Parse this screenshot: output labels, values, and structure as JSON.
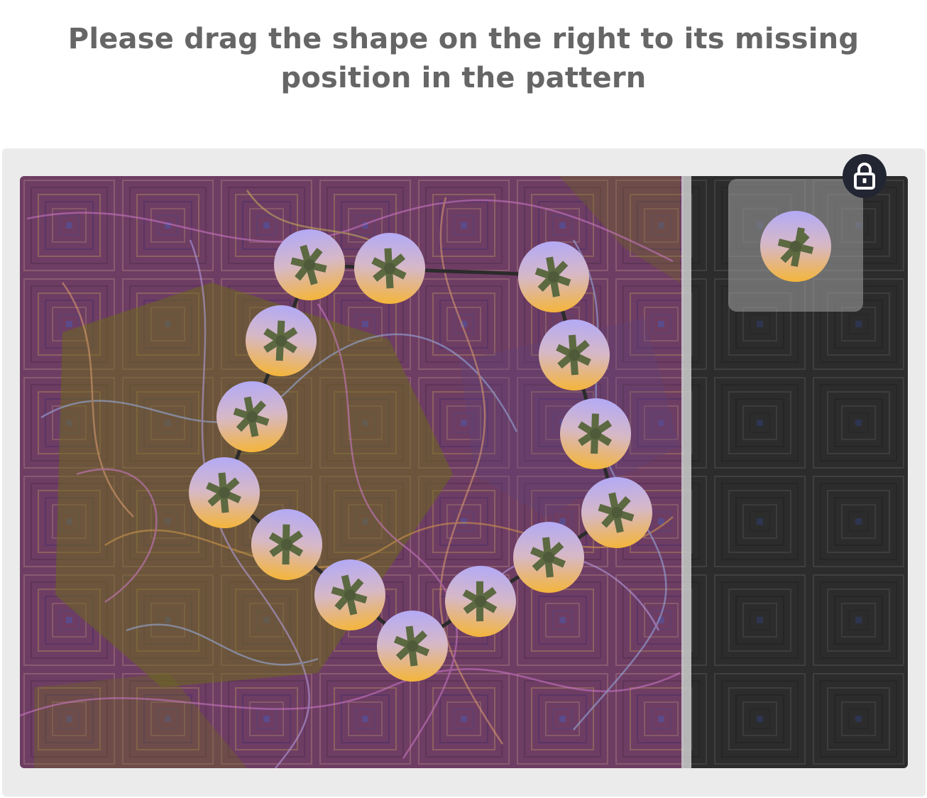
{
  "instruction": {
    "text": "Please drag the shape on the right to its missing position in the pattern"
  },
  "puzzle": {
    "lock_icon": "lock-icon",
    "piece_icon": "asterisk-knob-icon",
    "colors": {
      "frame": "#ebebeb",
      "board_left": "#6e3d63",
      "board_right": "#2e2e2e",
      "divider": "#c8c8c8",
      "lock_bg": "#222633",
      "piece_top": "#b8aef5",
      "piece_bottom": "#f2b43c",
      "cross": "#5d6a42"
    }
  }
}
